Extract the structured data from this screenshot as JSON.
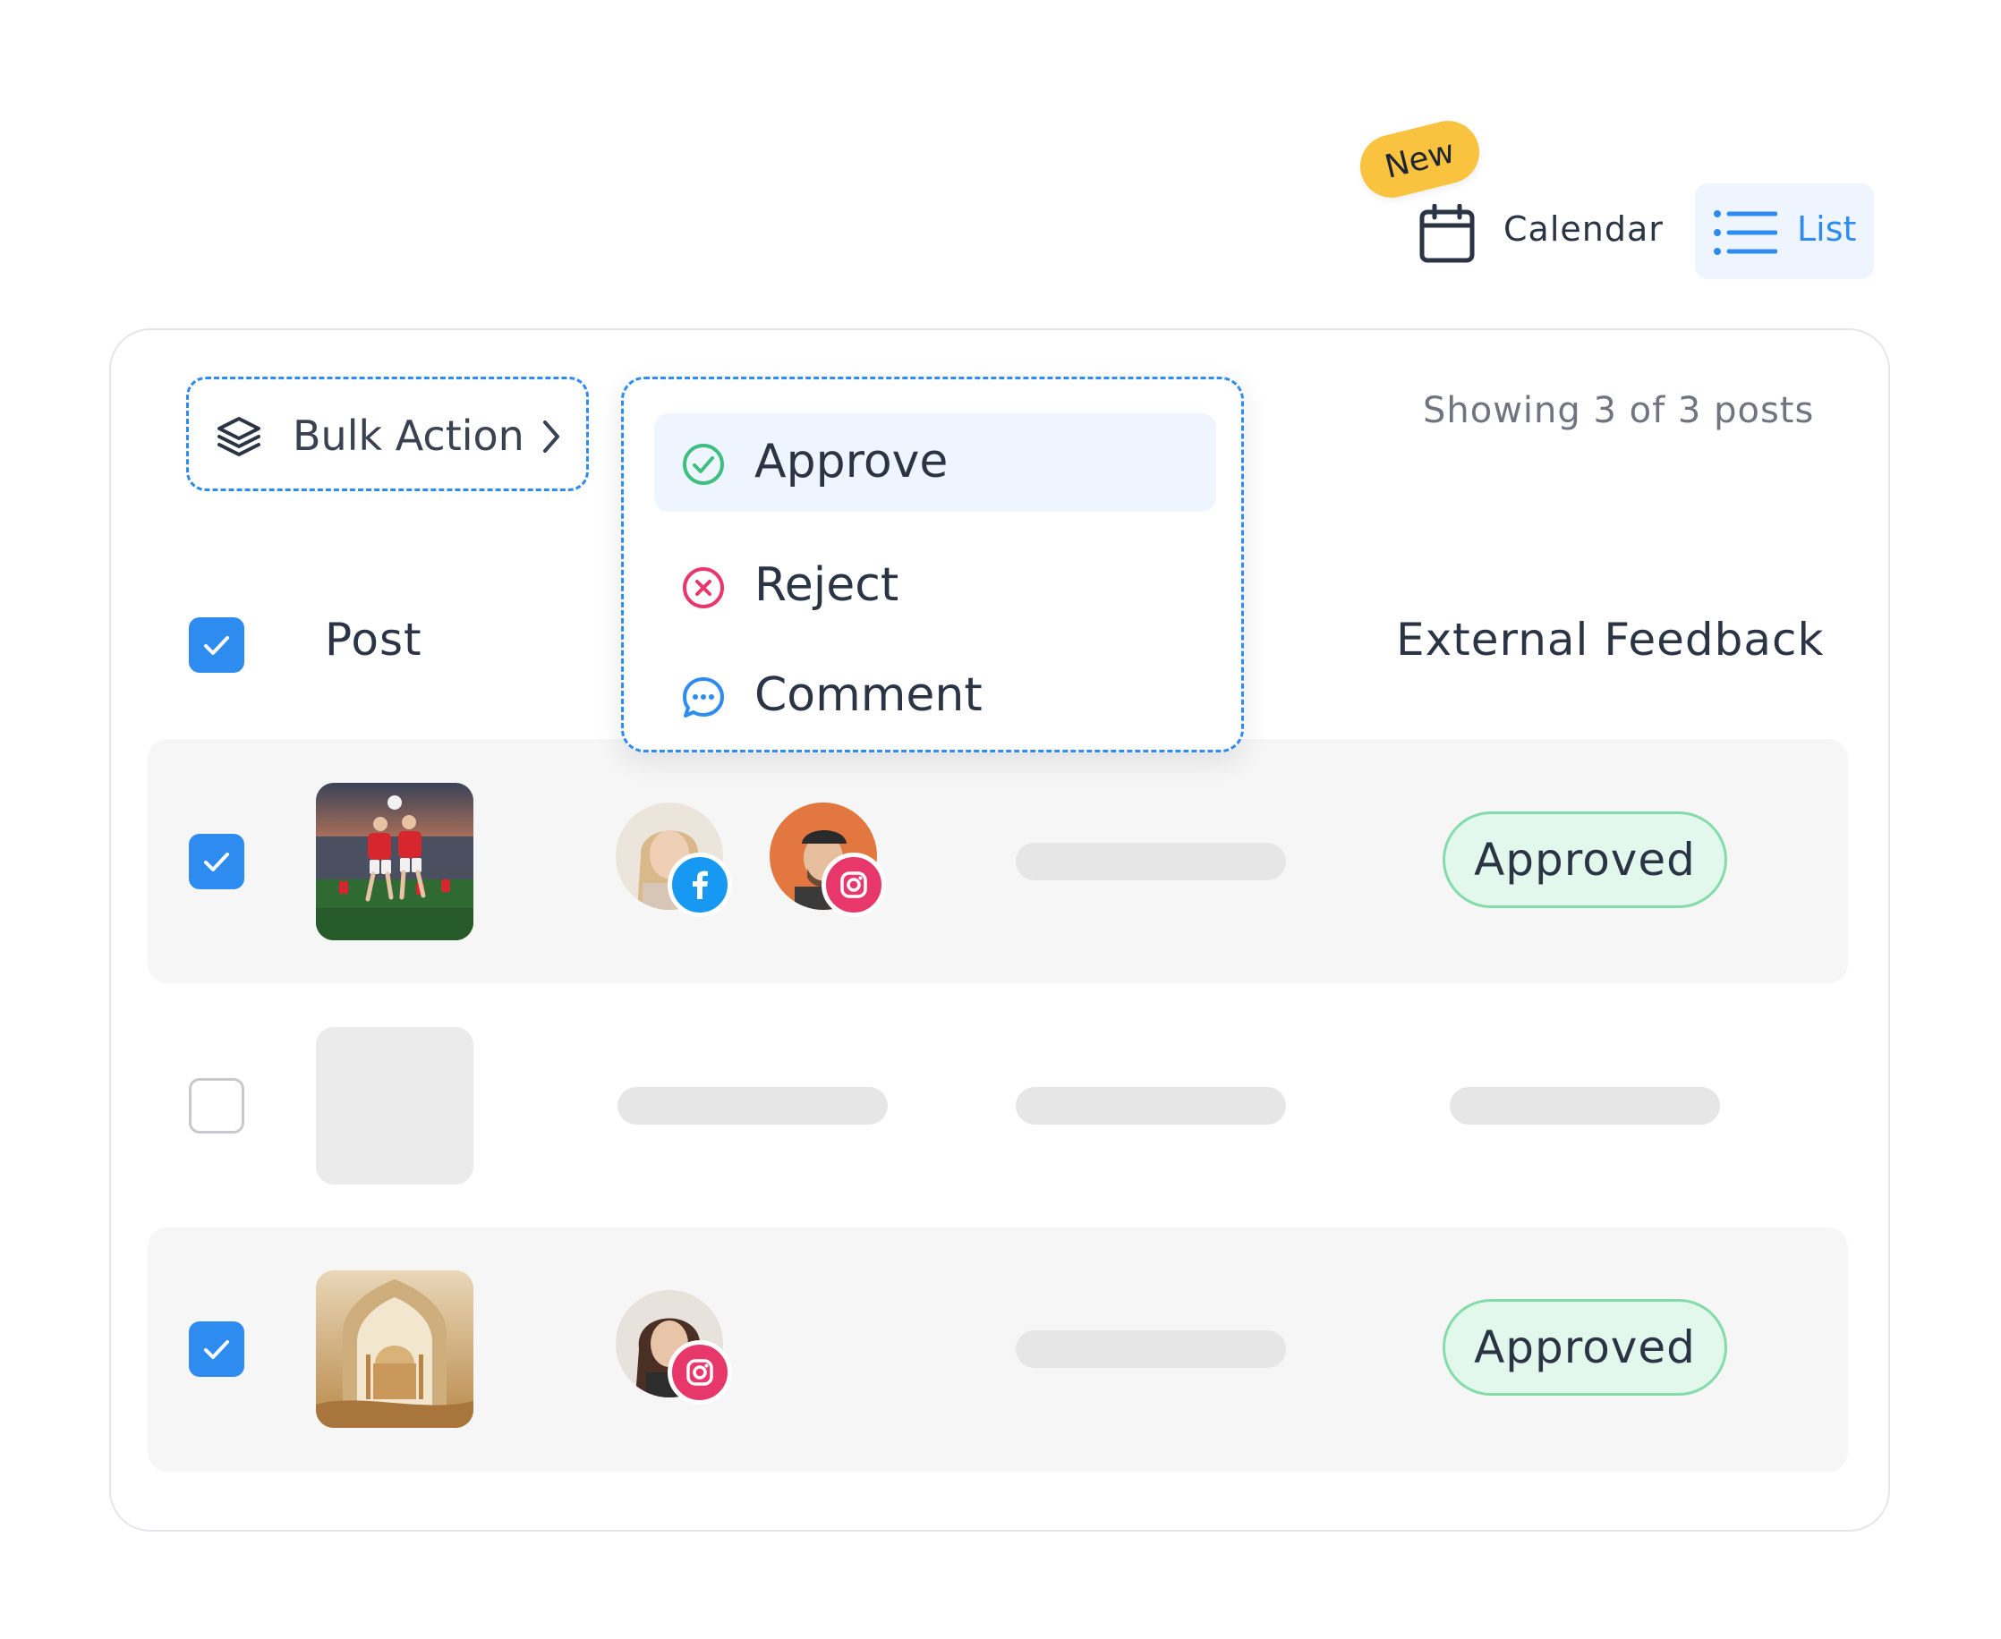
{
  "view_toggle": {
    "new_badge": "New",
    "calendar_label": "Calendar",
    "list_label": "List",
    "active_view": "List",
    "accent_color": "#2e8cf0"
  },
  "toolbar": {
    "bulk_action_label": "Bulk Action",
    "showing_text": "Showing 3 of 3 posts"
  },
  "bulk_menu": {
    "items": [
      {
        "label": "Approve",
        "icon": "check-circle-icon",
        "color": "#3fbf7f",
        "highlighted": true
      },
      {
        "label": "Reject",
        "icon": "x-circle-icon",
        "color": "#e8386b",
        "highlighted": false
      },
      {
        "label": "Comment",
        "icon": "chat-bubble-icon",
        "color": "#2e8cf0",
        "highlighted": false
      }
    ]
  },
  "table": {
    "headers": {
      "post": "Post",
      "external_feedback": "External Feedback"
    },
    "select_all_checked": true,
    "rows": [
      {
        "checked": true,
        "thumbnail": "soccer-thumbnail",
        "accounts": [
          {
            "avatar": "woman-blonde-avatar",
            "network": "facebook"
          },
          {
            "avatar": "man-cap-avatar",
            "network": "instagram"
          }
        ],
        "status": "Approved"
      },
      {
        "checked": false,
        "thumbnail": "placeholder",
        "accounts": [],
        "status": ""
      },
      {
        "checked": true,
        "thumbnail": "mosque-thumbnail",
        "accounts": [
          {
            "avatar": "woman-brunette-avatar",
            "network": "instagram"
          }
        ],
        "status": "Approved"
      }
    ]
  }
}
